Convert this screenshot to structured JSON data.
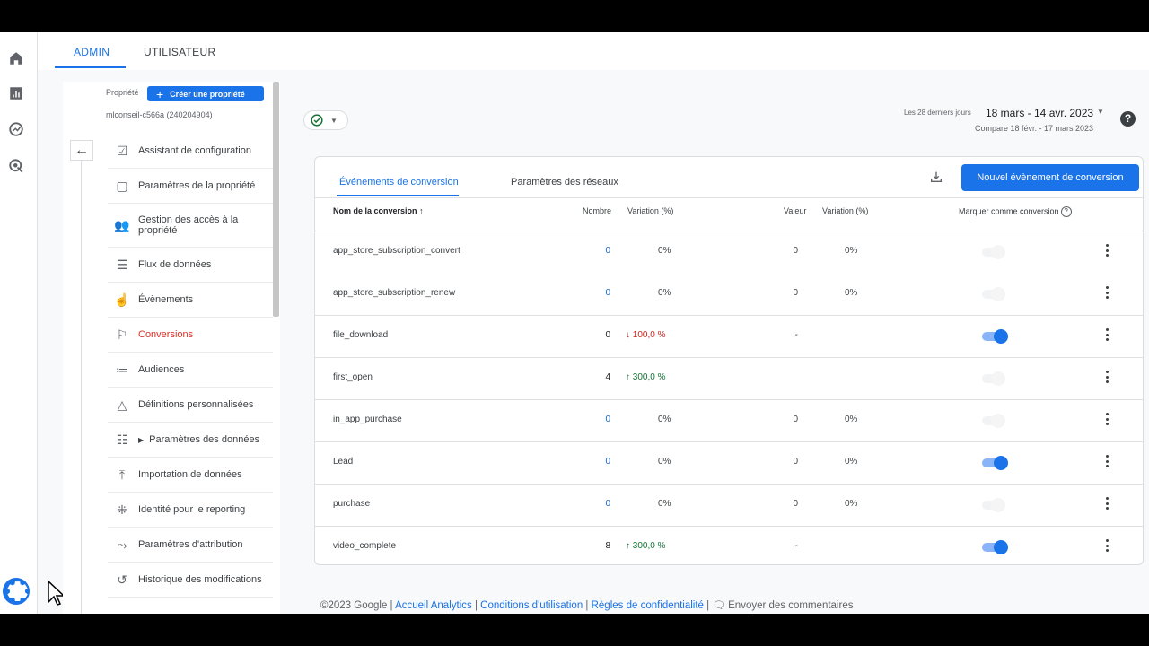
{
  "top_tabs": [
    "ADMIN",
    "UTILISATEUR"
  ],
  "property": {
    "label": "Propriété",
    "create_button": "Créer une propriété",
    "id": "mlconseil-c566a (240204904)"
  },
  "nav": [
    {
      "label": "Assistant de configuration",
      "icon": "checklist-icon"
    },
    {
      "label": "Paramètres de la propriété",
      "icon": "layout-icon"
    },
    {
      "label": "Gestion des accès à la propriété",
      "icon": "people-icon"
    },
    {
      "label": "Flux de données",
      "icon": "data-stream-icon"
    },
    {
      "label": "Évènements",
      "icon": "touch-icon"
    },
    {
      "label": "Conversions",
      "icon": "flag-icon",
      "active": true
    },
    {
      "label": "Audiences",
      "icon": "audience-icon"
    },
    {
      "label": "Définitions personnalisées",
      "icon": "shapes-icon"
    },
    {
      "label": "Paramètres des données",
      "icon": "database-icon",
      "expandable": true
    },
    {
      "label": "Importation de données",
      "icon": "upload-icon"
    },
    {
      "label": "Identité pour le reporting",
      "icon": "identity-icon"
    },
    {
      "label": "Paramètres d'attribution",
      "icon": "attribution-icon"
    },
    {
      "label": "Historique des modifications",
      "icon": "history-icon"
    }
  ],
  "date": {
    "period_label": "Les 28 derniers jours",
    "range": "18 mars - 14 avr. 2023",
    "compare": "Compare 18 févr. - 17 mars 2023"
  },
  "card": {
    "tabs": [
      "Événements de conversion",
      "Paramètres des réseaux"
    ],
    "new_button": "Nouvel évènement de conversion",
    "headers": {
      "name": "Nom de la conversion ↑",
      "count": "Nombre",
      "count_var": "Variation (%)",
      "value": "Valeur",
      "value_var": "Variation (%)",
      "mark": "Marquer comme conversion"
    },
    "rows": [
      {
        "name": "app_store_subscription_convert",
        "count": "0",
        "var": "0%",
        "value": "0",
        "var2": "0%",
        "toggle": false
      },
      {
        "name": "app_store_subscription_renew",
        "count": "0",
        "var": "0%",
        "value": "0",
        "var2": "0%",
        "toggle": false
      },
      {
        "name": "file_download",
        "count": "0",
        "var": "↓ 100,0 %",
        "value": "-",
        "var2": "",
        "toggle": true
      },
      {
        "name": "first_open",
        "count": "4",
        "var": "↑ 300,0 %",
        "value": "",
        "var2": "",
        "toggle": false
      },
      {
        "name": "in_app_purchase",
        "count": "0",
        "var": "0%",
        "value": "0",
        "var2": "0%",
        "toggle": false
      },
      {
        "name": "Lead",
        "count": "0",
        "var": "0%",
        "value": "0",
        "var2": "0%",
        "toggle": true
      },
      {
        "name": "purchase",
        "count": "0",
        "var": "0%",
        "value": "0",
        "var2": "0%",
        "toggle": false
      },
      {
        "name": "video_complete",
        "count": "8",
        "var": "↑ 300,0 %",
        "value": "-",
        "var2": "",
        "toggle": true
      }
    ]
  },
  "footer": {
    "copyright": "©2023 Google",
    "links": [
      "Accueil Analytics",
      "Conditions d'utilisation",
      "Règles de confidentialité"
    ],
    "feedback": "Envoyer des commentaires"
  },
  "colors": {
    "accent": "#1a73e8",
    "active_nav": "#d93025",
    "up": "#137333",
    "down": "#c5221f"
  }
}
